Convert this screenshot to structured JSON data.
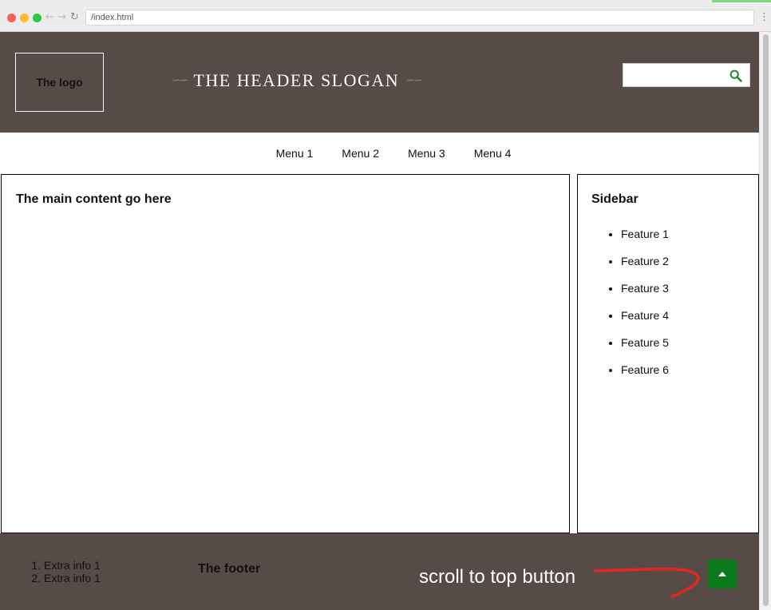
{
  "browser": {
    "url": "/index.html",
    "back_icon": "arrow-left-icon",
    "forward_icon": "arrow-right-icon",
    "reload_icon": "reload-icon",
    "menu_icon": "kebab-menu-icon"
  },
  "header": {
    "logo_text": "The logo",
    "slogan": "THE HEADER SLOGAN",
    "ornament": "∽∽",
    "search": {
      "value": "",
      "icon": "search-icon",
      "icon_color": "#1a8a2a"
    },
    "background": "#564b47"
  },
  "menu": {
    "items": [
      {
        "label": "Menu 1"
      },
      {
        "label": "Menu 2"
      },
      {
        "label": "Menu 3"
      },
      {
        "label": "Menu 4"
      }
    ]
  },
  "main": {
    "heading": "The main content go here"
  },
  "sidebar": {
    "title": "Sidebar",
    "features": [
      {
        "label": "Feature 1"
      },
      {
        "label": "Feature 2"
      },
      {
        "label": "Feature 3"
      },
      {
        "label": "Feature 4"
      },
      {
        "label": "Feature 5"
      },
      {
        "label": "Feature 6"
      }
    ]
  },
  "footer": {
    "extra_info": [
      {
        "label": "Extra info 1"
      },
      {
        "label": "Extra info 1"
      }
    ],
    "title": "The footer",
    "annotation": "scroll to top button",
    "annotation_arrow_color": "#e8271b",
    "scroll_top_button": {
      "icon": "caret-up-icon",
      "color": "#0a7a1a"
    }
  }
}
